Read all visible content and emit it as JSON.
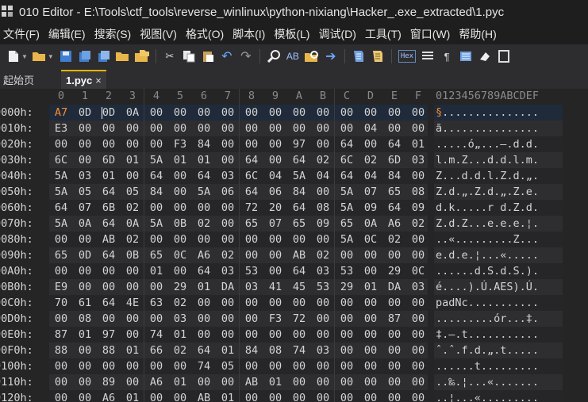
{
  "window": {
    "title": "010 Editor - E:\\Tools\\ctf_tools\\reverse_winlinux\\python-nixiang\\Hacker_.exe_extracted\\1.pyc"
  },
  "menu": [
    "文件(F)",
    "编辑(E)",
    "搜索(S)",
    "视图(V)",
    "格式(O)",
    "脚本(I)",
    "模板(L)",
    "调试(D)",
    "工具(T)",
    "窗口(W)",
    "帮助(H)"
  ],
  "toolbar": {
    "icons": [
      "new-file-icon",
      "open-folder-icon",
      "save-icon",
      "save-as-icon",
      "save-all-icon",
      "open-folder2-icon",
      "open-project-icon",
      "cut-icon",
      "copy-icon",
      "paste-icon",
      "undo-icon",
      "redo-icon",
      "find-icon",
      "replace-icon",
      "find-in-files-icon",
      "goto-icon",
      "run-script-icon",
      "run-template-icon",
      "hex-icon",
      "column-icon",
      "pilcrow-icon",
      "list-icon",
      "clear-icon"
    ],
    "hex_label": "Hex",
    "pilcrow": "¶"
  },
  "tabs": {
    "start": "起始页",
    "active": "1.pyc",
    "close": "×"
  },
  "editor": {
    "col_headers": [
      "0",
      "1",
      "2",
      "3",
      "4",
      "5",
      "6",
      "7",
      "8",
      "9",
      "A",
      "B",
      "C",
      "D",
      "E",
      "F"
    ],
    "ascii_header": "0123456789ABCDEF",
    "rows": [
      {
        "addr": "0000h:",
        "hex": [
          "A7",
          "0D",
          "0D",
          "0A",
          "00",
          "00",
          "00",
          "00",
          "00",
          "00",
          "00",
          "00",
          "00",
          "00",
          "00",
          "00"
        ],
        "ascii": "§..............."
      },
      {
        "addr": "0010h:",
        "hex": [
          "E3",
          "00",
          "00",
          "00",
          "00",
          "00",
          "00",
          "00",
          "00",
          "00",
          "00",
          "00",
          "00",
          "04",
          "00",
          "00"
        ],
        "ascii": "ã..............."
      },
      {
        "addr": "0020h:",
        "hex": [
          "00",
          "00",
          "00",
          "00",
          "00",
          "F3",
          "84",
          "00",
          "00",
          "00",
          "97",
          "00",
          "64",
          "00",
          "64",
          "01"
        ],
        "ascii": ".....ó„...—.d.d."
      },
      {
        "addr": "0030h:",
        "hex": [
          "6C",
          "00",
          "6D",
          "01",
          "5A",
          "01",
          "01",
          "00",
          "64",
          "00",
          "64",
          "02",
          "6C",
          "02",
          "6D",
          "03"
        ],
        "ascii": "l.m.Z...d.d.l.m."
      },
      {
        "addr": "0040h:",
        "hex": [
          "5A",
          "03",
          "01",
          "00",
          "64",
          "00",
          "64",
          "03",
          "6C",
          "04",
          "5A",
          "04",
          "64",
          "04",
          "84",
          "00"
        ],
        "ascii": "Z...d.d.l.Z.d.„."
      },
      {
        "addr": "0050h:",
        "hex": [
          "5A",
          "05",
          "64",
          "05",
          "84",
          "00",
          "5A",
          "06",
          "64",
          "06",
          "84",
          "00",
          "5A",
          "07",
          "65",
          "08"
        ],
        "ascii": "Z.d.„.Z.d.„.Z.e."
      },
      {
        "addr": "0060h:",
        "hex": [
          "64",
          "07",
          "6B",
          "02",
          "00",
          "00",
          "00",
          "00",
          "72",
          "20",
          "64",
          "08",
          "5A",
          "09",
          "64",
          "09"
        ],
        "ascii": "d.k.....r d.Z.d."
      },
      {
        "addr": "0070h:",
        "hex": [
          "5A",
          "0A",
          "64",
          "0A",
          "5A",
          "0B",
          "02",
          "00",
          "65",
          "07",
          "65",
          "09",
          "65",
          "0A",
          "A6",
          "02"
        ],
        "ascii": "Z.d.Z...e.e.e.¦."
      },
      {
        "addr": "0080h:",
        "hex": [
          "00",
          "00",
          "AB",
          "02",
          "00",
          "00",
          "00",
          "00",
          "00",
          "00",
          "00",
          "00",
          "5A",
          "0C",
          "02",
          "00"
        ],
        "ascii": "..«.........Z..."
      },
      {
        "addr": "0090h:",
        "hex": [
          "65",
          "0D",
          "64",
          "0B",
          "65",
          "0C",
          "A6",
          "02",
          "00",
          "00",
          "AB",
          "02",
          "00",
          "00",
          "00",
          "00"
        ],
        "ascii": "e.d.e.¦...«....."
      },
      {
        "addr": "00A0h:",
        "hex": [
          "00",
          "00",
          "00",
          "00",
          "01",
          "00",
          "64",
          "03",
          "53",
          "00",
          "64",
          "03",
          "53",
          "00",
          "29",
          "0C"
        ],
        "ascii": "......d.S.d.S.)."
      },
      {
        "addr": "00B0h:",
        "hex": [
          "E9",
          "00",
          "00",
          "00",
          "00",
          "29",
          "01",
          "DA",
          "03",
          "41",
          "45",
          "53",
          "29",
          "01",
          "DA",
          "03"
        ],
        "ascii": "é....).Ú.AES).Ú."
      },
      {
        "addr": "00C0h:",
        "hex": [
          "70",
          "61",
          "64",
          "4E",
          "63",
          "02",
          "00",
          "00",
          "00",
          "00",
          "00",
          "00",
          "00",
          "00",
          "00",
          "00"
        ],
        "ascii": "padNc..........."
      },
      {
        "addr": "00D0h:",
        "hex": [
          "00",
          "08",
          "00",
          "00",
          "00",
          "03",
          "00",
          "00",
          "00",
          "F3",
          "72",
          "00",
          "00",
          "00",
          "87",
          "00"
        ],
        "ascii": ".........ór...‡."
      },
      {
        "addr": "00E0h:",
        "hex": [
          "87",
          "01",
          "97",
          "00",
          "74",
          "01",
          "00",
          "00",
          "00",
          "00",
          "00",
          "00",
          "00",
          "00",
          "00",
          "00"
        ],
        "ascii": "‡.—.t..........."
      },
      {
        "addr": "00F0h:",
        "hex": [
          "88",
          "00",
          "88",
          "01",
          "66",
          "02",
          "64",
          "01",
          "84",
          "08",
          "74",
          "03",
          "00",
          "00",
          "00",
          "00"
        ],
        "ascii": "ˆ.ˆ.f.d.„.t....."
      },
      {
        "addr": "0100h:",
        "hex": [
          "00",
          "00",
          "00",
          "00",
          "00",
          "00",
          "74",
          "05",
          "00",
          "00",
          "00",
          "00",
          "00",
          "00",
          "00",
          "00"
        ],
        "ascii": "......t........."
      },
      {
        "addr": "0110h:",
        "hex": [
          "00",
          "00",
          "89",
          "00",
          "A6",
          "01",
          "00",
          "00",
          "AB",
          "01",
          "00",
          "00",
          "00",
          "00",
          "00",
          "00"
        ],
        "ascii": "..‰.¦...«......."
      },
      {
        "addr": "0120h:",
        "hex": [
          "00",
          "00",
          "A6",
          "01",
          "00",
          "00",
          "AB",
          "01",
          "00",
          "00",
          "00",
          "00",
          "00",
          "00",
          "00",
          "00"
        ],
        "ascii": "..¦...«........."
      }
    ]
  }
}
